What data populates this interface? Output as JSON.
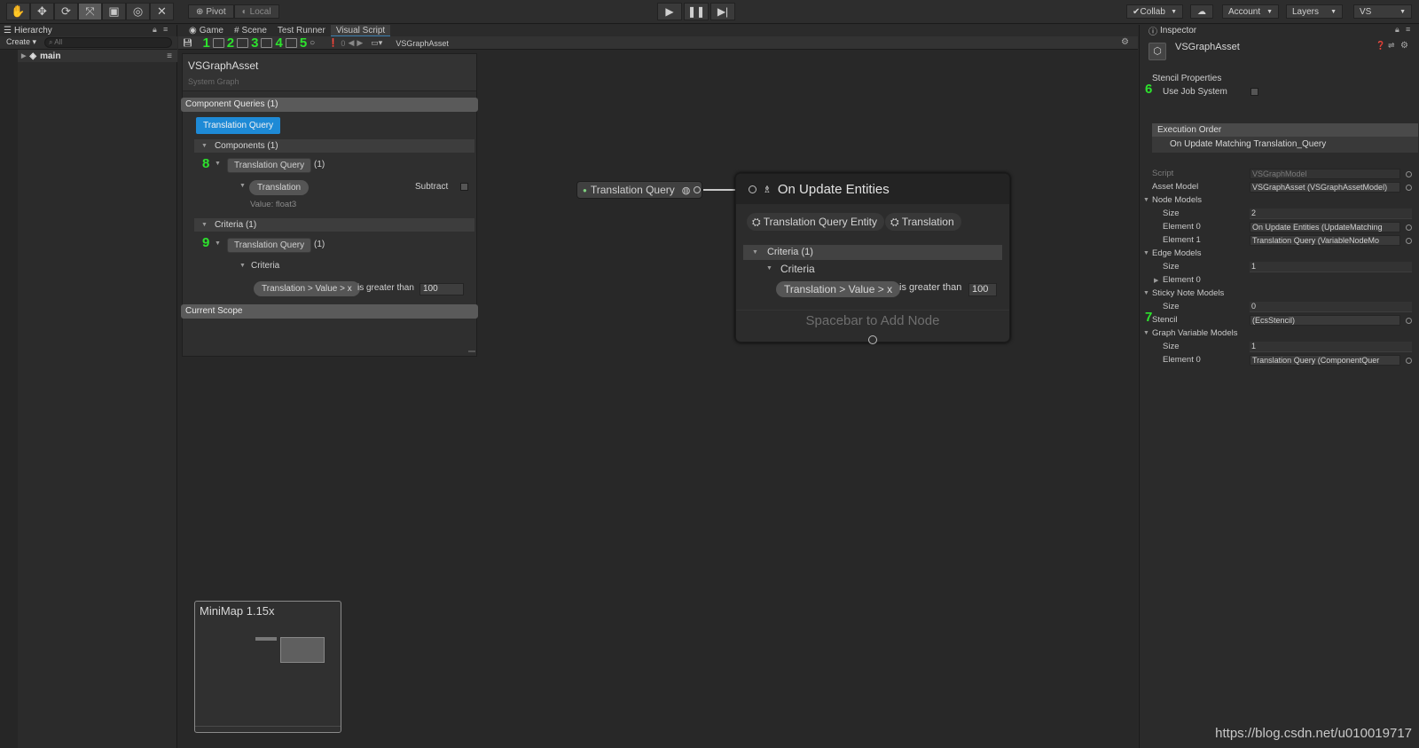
{
  "toolbar": {
    "pivot": "Pivot",
    "local": "Local",
    "collab": "Collab",
    "account": "Account",
    "layers": "Layers",
    "layout": "VS"
  },
  "hierarchy": {
    "tab": "Hierarchy",
    "create": "Create",
    "search_placeholder": "All",
    "scene": "main"
  },
  "tabs": [
    "Game",
    "Scene",
    "Test Runner",
    "Visual Script"
  ],
  "vs_toolbar": {
    "numbers": [
      "1",
      "2",
      "3",
      "4",
      "5"
    ],
    "error_count": "0",
    "asset_name": "VSGraphAsset"
  },
  "blackboard": {
    "title": "VSGraphAsset",
    "subtitle": "System Graph",
    "component_queries": "Component Queries (1)",
    "query_button": "Translation Query",
    "components_header": "Components (1)",
    "step_8": "8",
    "query_pill_1": "Translation Query",
    "count_1": "(1)",
    "translation_pill": "Translation",
    "subtract": "Subtract",
    "value_text": "Value:  float3",
    "criteria_header": "Criteria (1)",
    "step_9": "9",
    "query_pill_2": "Translation Query",
    "count_2": "(1)",
    "criteria_label": "Criteria",
    "criteria_field": "Translation > Value > x",
    "operator": "is greater than",
    "criteria_value": "100",
    "current_scope": "Current Scope"
  },
  "graph": {
    "variable_node": "Translation Query",
    "node_title": "On Update Entities",
    "chip_1": "Translation Query Entity",
    "chip_2": "Translation",
    "criteria_header": "Criteria (1)",
    "criteria_label": "Criteria",
    "criteria_field": "Translation > Value > x",
    "operator": "is greater than",
    "criteria_value": "100",
    "add_node": "Spacebar to Add Node"
  },
  "minimap": {
    "title": "MiniMap  1.15x"
  },
  "inspector": {
    "tab": "Inspector",
    "asset_name": "VSGraphAsset",
    "stencil_properties": "Stencil Properties",
    "step_6": "6",
    "use_job_system": "Use Job System",
    "execution_order": "Execution Order",
    "exec_item": "On Update Matching Translation_Query",
    "rows": [
      {
        "label": "Script",
        "value": "VSGraphModel",
        "dim": true
      },
      {
        "label": "Asset Model",
        "value": "VSGraphAsset (VSGraphAssetModel)"
      },
      {
        "label": "Node Models",
        "value": "",
        "header": true
      },
      {
        "label": "Size",
        "value": "2",
        "indent": true
      },
      {
        "label": "Element 0",
        "value": "On Update Entities (UpdateMatching",
        "indent": true
      },
      {
        "label": "Element 1",
        "value": "Translation Query (VariableNodeMo",
        "indent": true
      },
      {
        "label": "Edge Models",
        "value": "",
        "header": true
      },
      {
        "label": "Size",
        "value": "1",
        "indent": true
      },
      {
        "label": "Element 0",
        "value": "",
        "indent": true,
        "collapsed": true
      },
      {
        "label": "Sticky Note Models",
        "value": "",
        "header": true
      },
      {
        "label": "Size",
        "value": "0",
        "indent": true
      },
      {
        "label": "Stencil",
        "value": "(EcsStencil)",
        "step": "7"
      },
      {
        "label": "Graph Variable Models",
        "value": "",
        "header": true
      },
      {
        "label": "Size",
        "value": "1",
        "indent": true
      },
      {
        "label": "Element 0",
        "value": "Translation Query (ComponentQuer",
        "indent": true
      }
    ]
  },
  "watermark": "https://blog.csdn.net/u010019717"
}
